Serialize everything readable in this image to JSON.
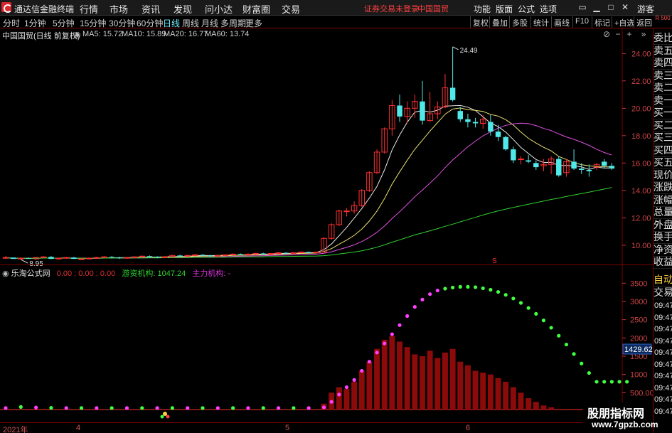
{
  "menubar": {
    "app_title": "通达信金融终端",
    "items": [
      "行情",
      "市场",
      "资讯",
      "发现",
      "问小达",
      "财富圈",
      "交易"
    ],
    "login_warning": "证券交易未登录",
    "login_stock": "中国国贸",
    "right_items": [
      "功能",
      "版面",
      "公式",
      "选项"
    ],
    "guest": "游客"
  },
  "periodbar": {
    "periods": [
      "分时",
      "1分钟",
      "5分钟",
      "15分钟",
      "30分钟",
      "60分钟",
      "日线",
      "周线",
      "月线",
      "多周期",
      "更多"
    ],
    "active": "日线",
    "tools": [
      "复权",
      "叠加",
      "多股",
      "统计",
      "画线",
      "F10",
      "标记",
      "+自选",
      "返回"
    ],
    "corner_label": "R 500"
  },
  "chart": {
    "title": "中国国贸(日线 前复权)",
    "ma": [
      {
        "label": "MA5: 15.72",
        "color": "#e8e8e8"
      },
      {
        "label": "MA10: 15.89",
        "color": "#e8e070"
      },
      {
        "label": "MA20: 16.77",
        "color": "#e050e0"
      },
      {
        "label": "MA60: 13.74",
        "color": "#30d030"
      }
    ],
    "high_label": "24.49",
    "low_label": "8.95",
    "y_ticks": [
      "24.00",
      "22.00",
      "20.00",
      "18.00",
      "16.00",
      "14.00",
      "12.00",
      "10.00"
    ],
    "marker": "S"
  },
  "indicator": {
    "name": "乐淘公式网",
    "values": "0.00 : 0.00 : 0.00",
    "youzi_label": "游资机构: 1047.24",
    "zhuli_label": "主力机构: -",
    "y_ticks": [
      "3500",
      "3000",
      "2500",
      "2000",
      "1500",
      "1000",
      "500.00"
    ],
    "current_value": "1429.62"
  },
  "sidepanel": {
    "items": [
      "委比",
      "卖五",
      "卖四",
      "卖三",
      "卖二",
      "卖一",
      "买一",
      "买二",
      "买三",
      "买四",
      "买五",
      "现价",
      "涨跌",
      "涨幅",
      "总量",
      "外盘",
      "换手",
      "净资",
      "收益"
    ],
    "auto_label": "自动",
    "trade_label": "交易",
    "times": [
      "09:47",
      "09:47",
      "09:47",
      "09:47",
      "09:47",
      "09:47",
      "09:47",
      "09:47",
      "09:47",
      "09:47"
    ]
  },
  "xaxis": {
    "labels": [
      "2021年",
      "4",
      "5",
      "6"
    ]
  },
  "watermark": {
    "main": "股朋指标网",
    "sub": "www.7gpzb.com"
  },
  "chart_data": {
    "type": "candlestick",
    "title": "中国国贸(日线 前复权)",
    "candles": [
      [
        9.1,
        9.2,
        9.0,
        9.1
      ],
      [
        9.1,
        9.1,
        9.0,
        9.0
      ],
      [
        9.0,
        9.1,
        8.95,
        9.05
      ],
      [
        9.05,
        9.1,
        9.0,
        9.0
      ],
      [
        9.0,
        9.1,
        8.95,
        9.1
      ],
      [
        9.1,
        9.2,
        9.05,
        9.15
      ],
      [
        9.15,
        9.2,
        9.0,
        9.0
      ],
      [
        9.0,
        9.1,
        8.95,
        9.05
      ],
      [
        9.05,
        9.15,
        9.0,
        9.1
      ],
      [
        9.1,
        9.15,
        9.0,
        9.0
      ],
      [
        9.0,
        9.05,
        8.95,
        9.0
      ],
      [
        9.0,
        9.1,
        8.95,
        9.05
      ],
      [
        9.05,
        9.15,
        9.0,
        9.1
      ],
      [
        9.1,
        9.2,
        9.05,
        9.15
      ],
      [
        9.15,
        9.2,
        9.05,
        9.1
      ],
      [
        9.1,
        9.15,
        9.0,
        9.05
      ],
      [
        9.05,
        9.1,
        9.0,
        9.1
      ],
      [
        9.1,
        9.2,
        9.05,
        9.15
      ],
      [
        9.15,
        9.25,
        9.1,
        9.2
      ],
      [
        9.2,
        9.25,
        9.1,
        9.15
      ],
      [
        9.15,
        9.2,
        9.05,
        9.1
      ],
      [
        9.1,
        9.2,
        9.05,
        9.15
      ],
      [
        9.15,
        9.3,
        9.1,
        9.25
      ],
      [
        9.25,
        9.3,
        9.15,
        9.2
      ],
      [
        9.2,
        9.3,
        9.15,
        9.25
      ],
      [
        9.25,
        9.35,
        9.2,
        9.3
      ],
      [
        9.3,
        9.35,
        9.2,
        9.25
      ],
      [
        9.25,
        9.3,
        9.15,
        9.2
      ],
      [
        9.2,
        9.3,
        9.15,
        9.25
      ],
      [
        9.25,
        9.3,
        9.2,
        9.3
      ],
      [
        9.3,
        9.4,
        9.25,
        9.35
      ],
      [
        9.35,
        9.4,
        9.25,
        9.3
      ],
      [
        9.3,
        9.4,
        9.25,
        9.35
      ],
      [
        9.35,
        9.45,
        9.3,
        9.4
      ],
      [
        9.4,
        9.45,
        9.3,
        9.35
      ],
      [
        9.35,
        9.4,
        9.3,
        9.4
      ],
      [
        9.4,
        9.5,
        9.35,
        9.45
      ],
      [
        9.45,
        9.5,
        9.35,
        9.4
      ],
      [
        9.4,
        9.5,
        9.35,
        9.45
      ],
      [
        9.45,
        9.55,
        9.4,
        9.5
      ],
      [
        9.5,
        9.55,
        9.4,
        9.45
      ],
      [
        9.45,
        9.55,
        9.4,
        9.5
      ],
      [
        9.5,
        10.6,
        9.5,
        10.5
      ],
      [
        10.5,
        11.6,
        10.4,
        11.5
      ],
      [
        11.5,
        12.6,
        11.4,
        12.5
      ],
      [
        12.5,
        12.7,
        12.1,
        12.5
      ],
      [
        12.5,
        13.2,
        12.3,
        12.9
      ],
      [
        12.9,
        14.1,
        12.8,
        14.0
      ],
      [
        14.0,
        15.4,
        13.9,
        15.3
      ],
      [
        15.3,
        17.0,
        15.2,
        16.8
      ],
      [
        16.8,
        18.6,
        16.7,
        18.5
      ],
      [
        18.5,
        20.6,
        18.0,
        20.2
      ],
      [
        20.2,
        21.0,
        19.0,
        19.4
      ],
      [
        19.4,
        20.5,
        18.9,
        20.0
      ],
      [
        20.0,
        21.0,
        19.3,
        20.5
      ],
      [
        20.5,
        22.0,
        18.8,
        19.1
      ],
      [
        19.1,
        21.2,
        19.0,
        19.6
      ],
      [
        19.6,
        20.5,
        19.2,
        20.1
      ],
      [
        20.1,
        22.5,
        20.0,
        21.5
      ],
      [
        21.5,
        24.49,
        20.5,
        20.6
      ],
      [
        19.8,
        20.1,
        19.0,
        19.2
      ],
      [
        19.2,
        19.6,
        18.6,
        19.0
      ],
      [
        19.0,
        19.3,
        18.6,
        18.9
      ],
      [
        18.9,
        19.5,
        18.5,
        19.2
      ],
      [
        19.0,
        19.5,
        18.0,
        18.3
      ],
      [
        18.3,
        18.8,
        17.6,
        17.9
      ],
      [
        17.9,
        18.0,
        16.9,
        17.0
      ],
      [
        17.0,
        17.2,
        16.0,
        16.2
      ],
      [
        16.3,
        16.5,
        15.9,
        16.3
      ],
      [
        16.2,
        16.6,
        16.0,
        16.1
      ],
      [
        16.0,
        16.2,
        15.5,
        15.7
      ],
      [
        15.8,
        16.3,
        15.4,
        15.9
      ],
      [
        15.9,
        16.5,
        15.2,
        16.3
      ],
      [
        16.3,
        16.5,
        15.0,
        15.1
      ],
      [
        15.3,
        16.3,
        15.0,
        16.1
      ],
      [
        16.1,
        17.0,
        15.5,
        15.6
      ],
      [
        15.6,
        16.0,
        15.2,
        15.5
      ],
      [
        15.5,
        15.9,
        15.0,
        15.4
      ],
      [
        15.7,
        16.0,
        15.5,
        15.9
      ],
      [
        16.1,
        16.3,
        15.6,
        15.8
      ],
      [
        15.8,
        16.0,
        15.5,
        15.6
      ]
    ],
    "ma_last": {
      "MA5": 15.72,
      "MA10": 15.89,
      "MA20": 16.77,
      "MA60": 13.74
    },
    "high": 24.49,
    "low": 8.95,
    "ylim": [
      8.8,
      25.0
    ],
    "volume_bars": [
      0,
      0,
      0,
      0,
      0,
      0,
      0,
      0,
      0,
      0,
      0,
      0,
      0,
      0,
      0,
      0,
      0,
      0,
      0,
      0,
      0,
      0,
      0,
      0,
      0,
      0,
      0,
      0,
      0,
      0,
      0,
      0,
      0,
      0,
      0,
      0,
      0,
      0,
      0,
      0,
      0,
      0,
      200,
      500,
      650,
      600,
      800,
      1100,
      1350,
      1700,
      1950,
      2050,
      1900,
      1750,
      1550,
      1500,
      1650,
      1450,
      1600,
      1700,
      1350,
      1250,
      1100,
      1050,
      1000,
      900,
      800,
      650,
      500,
      350,
      250,
      150,
      100,
      60,
      40,
      20,
      0,
      0,
      0,
      0,
      0
    ],
    "dots": [
      80,
      100,
      110,
      100,
      95,
      90,
      85,
      80,
      80,
      80,
      80,
      80,
      80,
      80,
      80,
      80,
      80,
      80,
      80,
      80,
      80,
      80,
      80,
      80,
      80,
      80,
      80,
      80,
      80,
      80,
      80,
      80,
      80,
      80,
      80,
      80,
      80,
      80,
      80,
      80,
      80,
      80,
      100,
      250,
      450,
      650,
      850,
      1100,
      1350,
      1600,
      1850,
      2100,
      2350,
      2600,
      2850,
      3050,
      3200,
      3300,
      3350,
      3380,
      3400,
      3400,
      3390,
      3360,
      3320,
      3260,
      3180,
      3080,
      2960,
      2820,
      2660,
      2480,
      2280,
      2060,
      1820,
      1560,
      1300,
      1040,
      800,
      800,
      800,
      800,
      800
    ],
    "dot_split": 58,
    "indicator_ylim": [
      0,
      3700
    ]
  }
}
